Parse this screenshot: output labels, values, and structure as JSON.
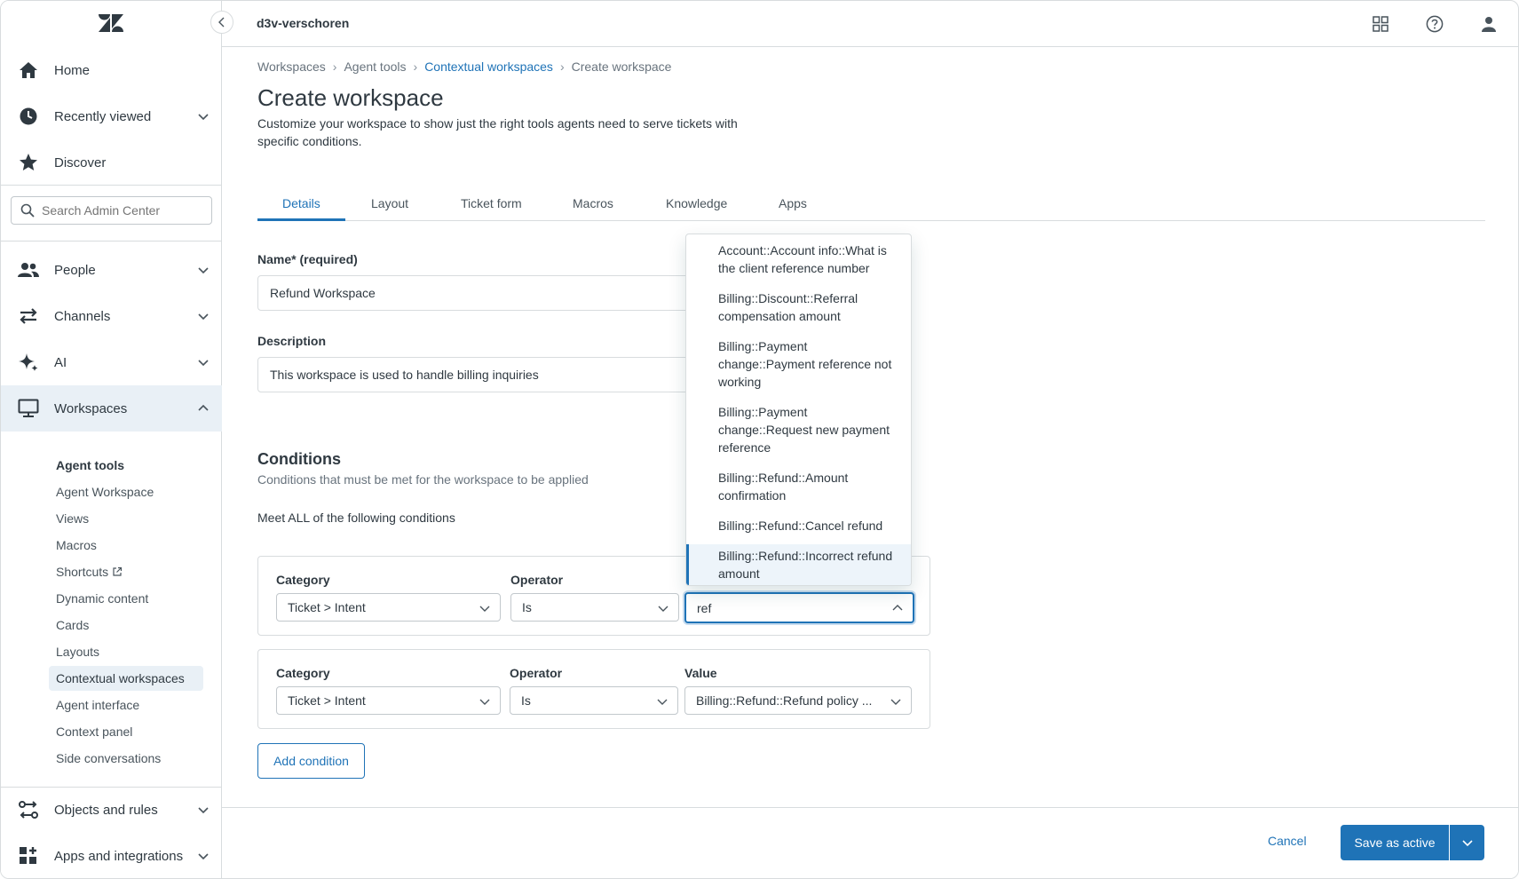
{
  "app": {
    "account_name": "d3v-verschoren",
    "brand_color": "#1f73b7"
  },
  "sidebar": {
    "top_items": [
      {
        "label": "Home",
        "icon": "home-icon"
      },
      {
        "label": "Recently viewed",
        "icon": "clock-icon"
      },
      {
        "label": "Discover",
        "icon": "star-icon"
      }
    ],
    "search_placeholder": "Search Admin Center",
    "sections": [
      {
        "label": "People",
        "icon": "people-icon"
      },
      {
        "label": "Channels",
        "icon": "channels-icon"
      },
      {
        "label": "AI",
        "icon": "sparkle-icon"
      },
      {
        "label": "Workspaces",
        "icon": "monitor-icon"
      }
    ],
    "workspaces_subnav": {
      "heading": "Agent tools",
      "items": [
        "Agent Workspace",
        "Views",
        "Macros",
        "Shortcuts",
        "Dynamic content",
        "Cards",
        "Layouts",
        "Contextual workspaces",
        "Agent interface",
        "Context panel",
        "Side conversations"
      ],
      "active": "Contextual workspaces"
    },
    "bottom_items": [
      {
        "label": "Objects and rules",
        "icon": "objects-rules-icon"
      },
      {
        "label": "Apps and integrations",
        "icon": "apps-grid-icon"
      }
    ]
  },
  "breadcrumb": [
    "Workspaces",
    "Agent tools",
    "Contextual workspaces",
    "Create workspace"
  ],
  "page": {
    "title": "Create workspace",
    "description": "Customize your workspace to show just the right tools agents need to serve tickets with specific conditions."
  },
  "tabs": [
    "Details",
    "Layout",
    "Ticket form",
    "Macros",
    "Knowledge",
    "Apps"
  ],
  "form": {
    "name_label": "Name* (required)",
    "name_value": "Refund Workspace",
    "description_label": "Description",
    "description_value": "This workspace is used to handle billing inquiries"
  },
  "conditions": {
    "title": "Conditions",
    "subtitle": "Conditions that must be met for the workspace to be applied",
    "meet_all": "Meet ALL of the following conditions",
    "category_label": "Category",
    "operator_label": "Operator",
    "value_label": "Value",
    "rows": [
      {
        "category": "Ticket > Intent",
        "operator": "Is",
        "value": "ref"
      },
      {
        "category": "Ticket > Intent",
        "operator": "Is",
        "value": "Billing::Refund::Refund policy ..."
      }
    ],
    "add_label": "Add condition"
  },
  "dropdown": {
    "options": [
      "Account::Account info::What is the client reference number",
      "Billing::Discount::Referral compensation amount",
      "Billing::Payment change::Payment reference not working",
      "Billing::Payment change::Request new payment reference",
      "Billing::Refund::Amount confirmation",
      "Billing::Refund::Cancel refund",
      "Billing::Refund::Incorrect refund amount"
    ],
    "highlighted": "Billing::Refund::Incorrect refund amount"
  },
  "footer": {
    "cancel_label": "Cancel",
    "save_label": "Save as active"
  }
}
